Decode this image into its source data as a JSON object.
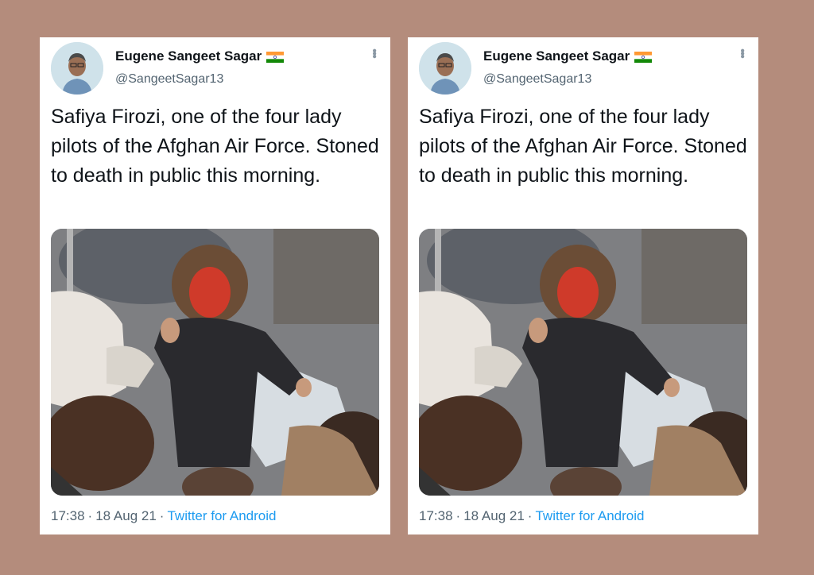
{
  "tweets": [
    {
      "author_name": "Eugene Sangeet Sagar",
      "handle": "@SangeetSagar13",
      "text": "Safiya Firozi, one of the four lady pilots of the Afghan Air Force. Stoned to death in public this morning.",
      "time": "17:38",
      "date": "18 Aug 21",
      "source": "Twitter for Android",
      "flag_icon": "india-flag-icon",
      "menu_icon": "more-vertical-icon"
    },
    {
      "author_name": "Eugene Sangeet Sagar",
      "handle": "@SangeetSagar13",
      "text": "Safiya Firozi, one of the four lady pilots of the Afghan Air Force. Stoned to death in public this morning.",
      "time": "17:38",
      "date": "18 Aug 21",
      "source": "Twitter for Android",
      "flag_icon": "india-flag-icon",
      "menu_icon": "more-vertical-icon"
    }
  ],
  "colors": {
    "background": "#b48c7c",
    "card": "#ffffff",
    "text_primary": "#0f1419",
    "text_secondary": "#536471",
    "link": "#1d9bf0"
  }
}
